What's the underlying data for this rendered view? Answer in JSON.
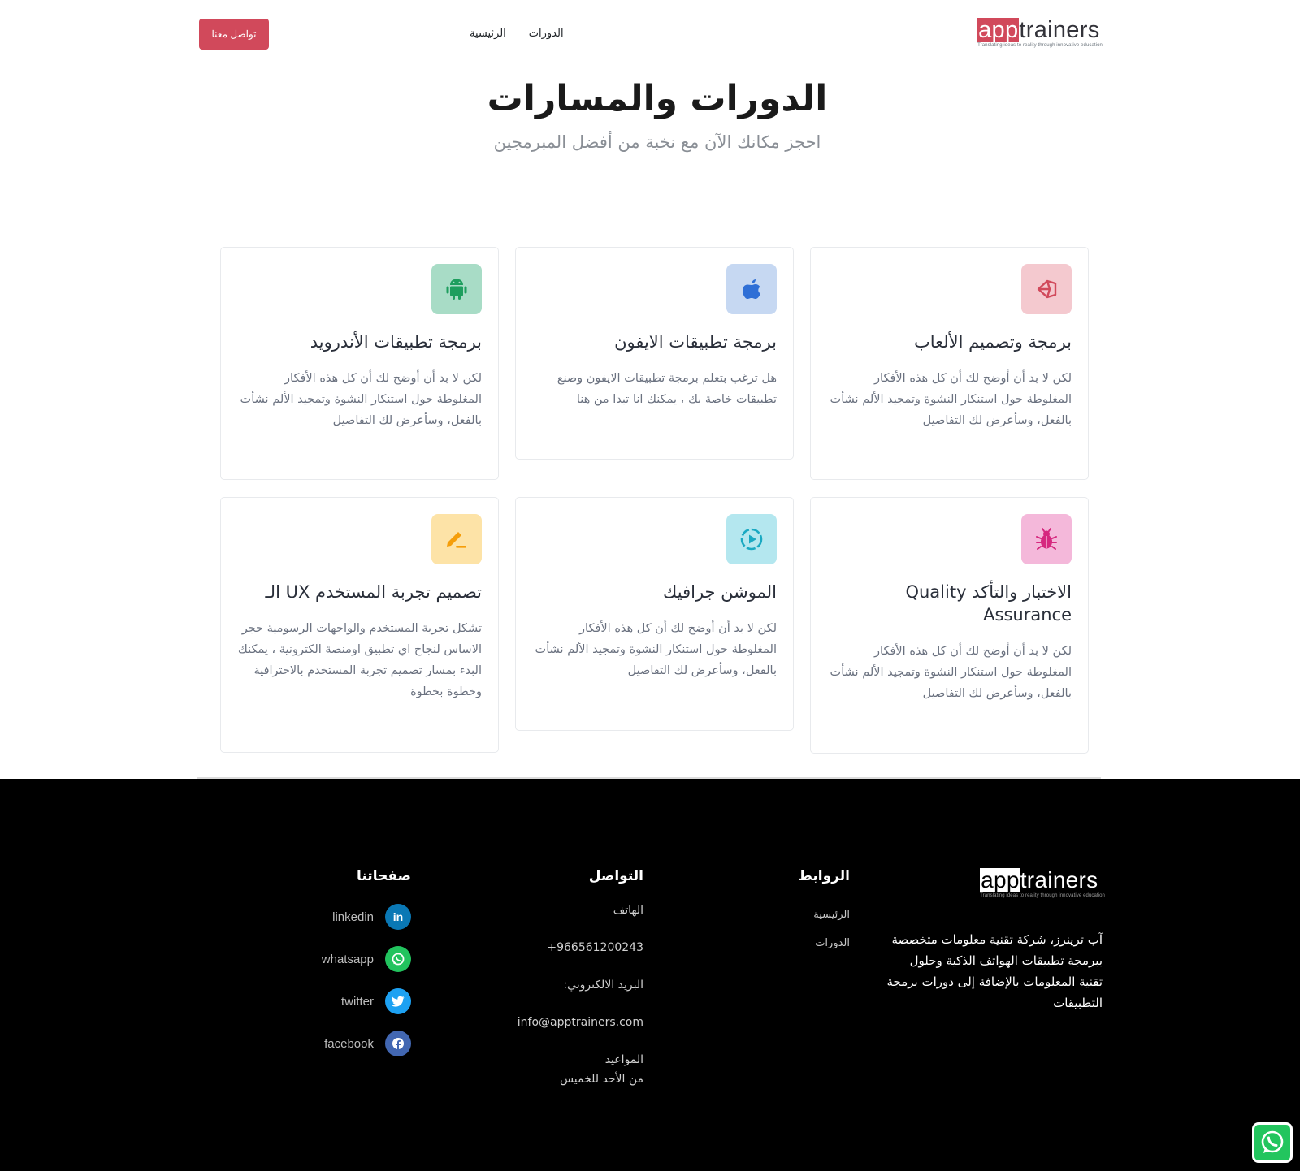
{
  "header": {
    "logo_app": "app",
    "logo_rest": "trainers",
    "logo_tagline": "Translating ideas to reality through innovative education",
    "nav": [
      {
        "label": "الرئيسية"
      },
      {
        "label": "الدورات"
      }
    ],
    "contact_button": "تواصل معنا"
  },
  "hero": {
    "title": "الدورات والمسارات",
    "subtitle": "احجز مكانك الآن مع نخبة من أفضل المبرمجين"
  },
  "courses": [
    {
      "title": "برمجة وتصميم الألعاب",
      "description": "لكن لا بد أن أوضح لك أن كل هذه الأفكار المغلوطة حول استنكار النشوة وتمجيد الألم نشأت بالفعل، وسأعرض لك التفاصيل",
      "icon": "unity-icon",
      "icon_bg": "#f4c9cf",
      "icon_color": "#d1495b"
    },
    {
      "title": "برمجة تطبيقات الايفون",
      "description": "هل ترغب بتعلم برمجة تطبيقات الايفون وصنع تطبيقات خاصة بك ، يمكنك انا تبدا من هنا",
      "icon": "apple-icon",
      "icon_bg": "#c6d8f2",
      "icon_color": "#2f6fd6"
    },
    {
      "title": "برمجة تطبيقات الأندرويد",
      "description": "لكن لا بد أن أوضح لك أن كل هذه الأفكار المغلوطة حول استنكار النشوة وتمجيد الألم نشأت بالفعل، وسأعرض لك التفاصيل",
      "icon": "android-icon",
      "icon_bg": "#a8dcc6",
      "icon_color": "#1e9e5e"
    },
    {
      "title": "الاختبار والتأكد Quality Assurance",
      "description": "لكن لا بد أن أوضح لك أن كل هذه الأفكار المغلوطة حول استنكار النشوة وتمجيد الألم نشأت بالفعل، وسأعرض لك التفاصيل",
      "icon": "bug-icon",
      "icon_bg": "#f4b8da",
      "icon_color": "#d6287f"
    },
    {
      "title": "الموشن جرافيك",
      "description": "لكن لا بد أن أوضح لك أن كل هذه الأفكار المغلوطة حول استنكار النشوة وتمجيد الألم نشأت بالفعل، وسأعرض لك التفاصيل",
      "icon": "motion-play-icon",
      "icon_bg": "#b4e7ef",
      "icon_color": "#1aa9c2"
    },
    {
      "title": "تصميم تجربة المستخدم UX الـ",
      "description": "تشكل تجربة المستخدم والواجهات الرسومية حجر الاساس لنجاح اي تطبيق اومنصة الكترونية ، يمكنك البدء بمسار تصميم تجربة المستخدم بالاحترافية وخطوة بخطوة",
      "icon": "pencil-icon",
      "icon_bg": "#fde3a7",
      "icon_color": "#f59e0b"
    }
  ],
  "footer": {
    "logo_app": "app",
    "logo_rest": "trainers",
    "logo_tagline": "Translating ideas to reality through innovative education",
    "about": "آب ترينرز، شركة تقنية معلومات متخصصة ببرمجة تطبيقات الهواتف الذكية وحلول تقنية المعلومات بالإضافة إلى دورات برمجة التطبيقات",
    "links_title": "الروابط",
    "links": [
      {
        "label": "الرئيسية"
      },
      {
        "label": "الدورات"
      }
    ],
    "contact_title": "التواصل",
    "phone_label": "الهاتف",
    "phone": "+966561200243",
    "email_label": "البريد الالكتروني:",
    "email": "info@apptrainers.com",
    "hours_label": "المواعيد",
    "hours": "من الأحد للخميس",
    "pages_title": "صفحاتنا",
    "socials": [
      {
        "label": "linkedin",
        "icon": "linkedin-icon",
        "color": "#0a78b5",
        "glyph": "in"
      },
      {
        "label": "whatsapp",
        "icon": "whatsapp-icon",
        "color": "#22c35e",
        "glyph": "w"
      },
      {
        "label": "twitter",
        "icon": "twitter-icon",
        "color": "#1da1f2",
        "glyph": "t"
      },
      {
        "label": "facebook",
        "icon": "facebook-icon",
        "color": "#4267b2",
        "glyph": "f"
      }
    ]
  }
}
